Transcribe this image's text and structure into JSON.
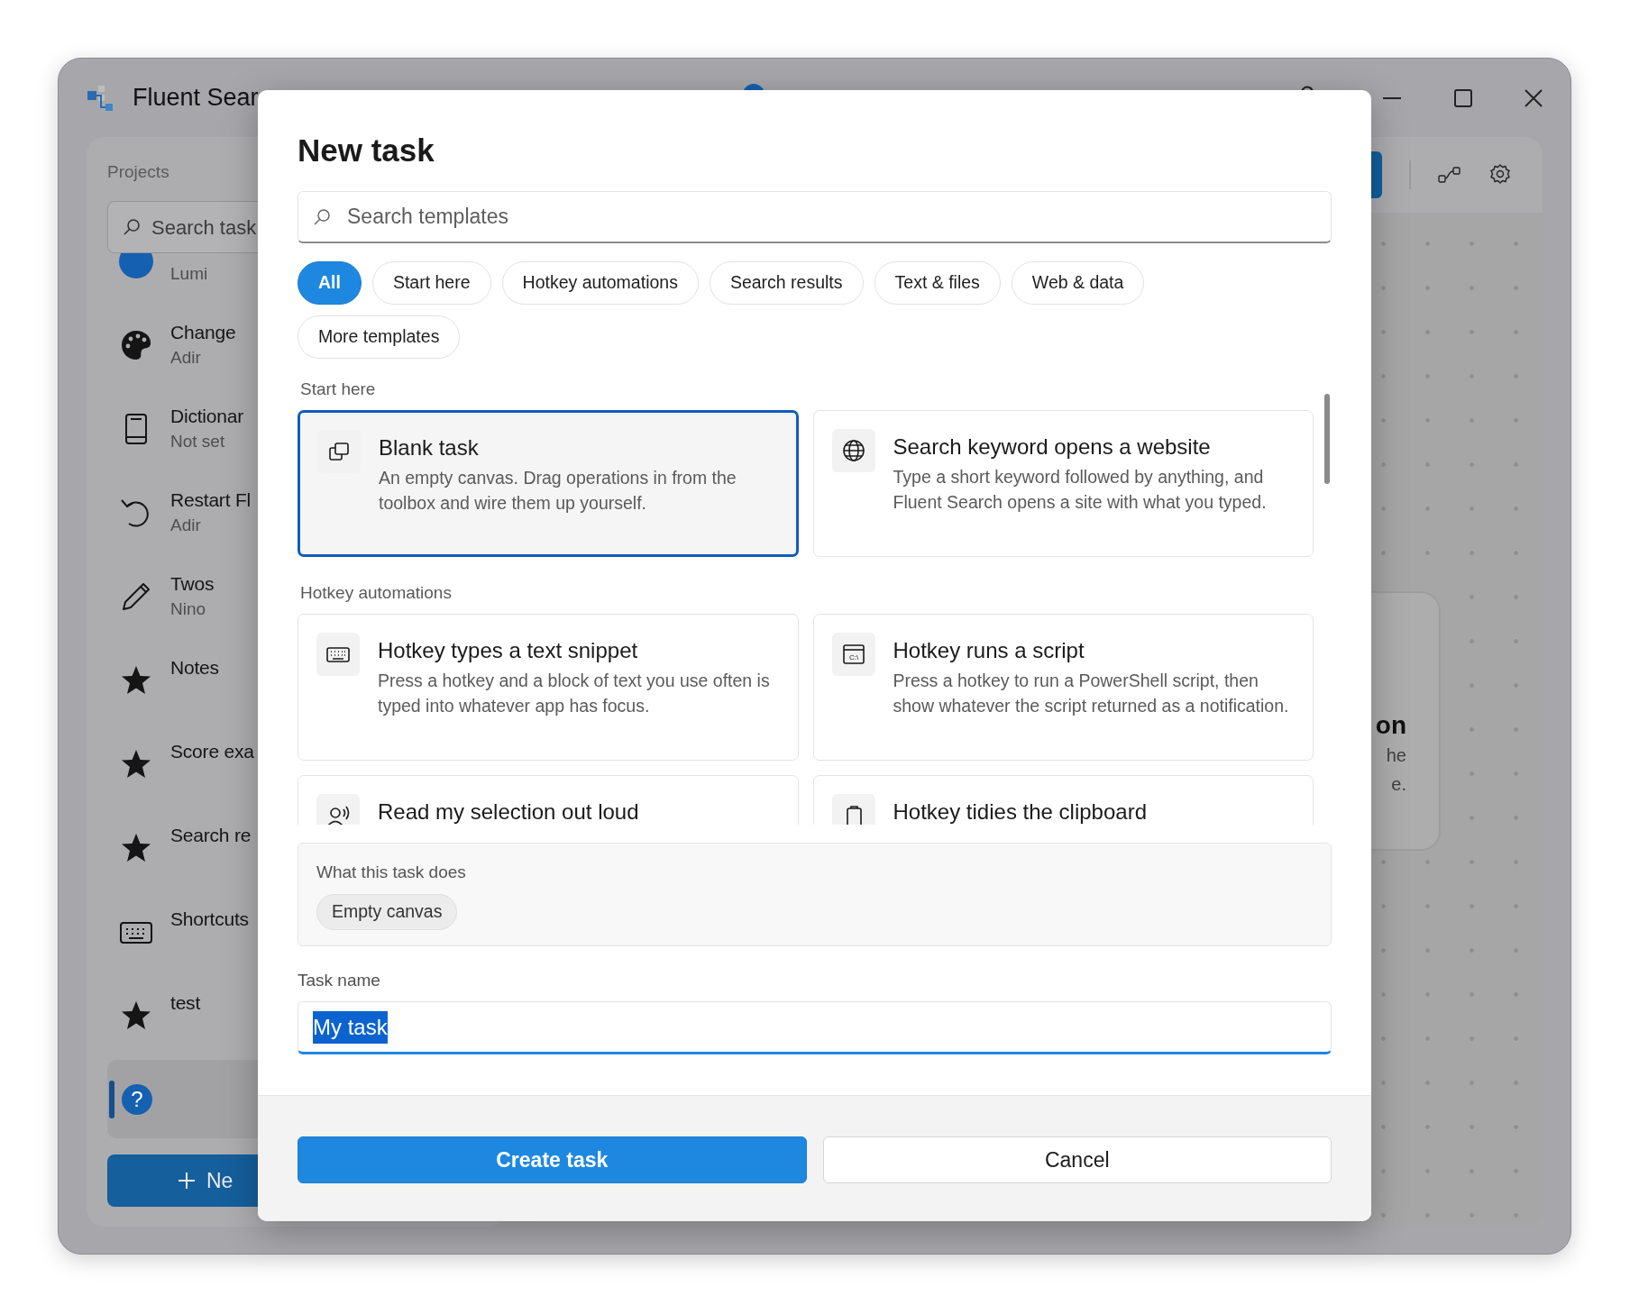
{
  "window": {
    "title": "Fluent Sear"
  },
  "sidebar": {
    "heading": "Projects",
    "search": {
      "placeholder": "Search task"
    },
    "projects": [
      {
        "owner": "Lumi"
      },
      {
        "name": "Change",
        "owner": "Adir"
      },
      {
        "name": "Dictionar",
        "owner": "Not set"
      },
      {
        "name": "Restart Fl",
        "owner": "Adir"
      },
      {
        "name": "Twos",
        "owner": "Nino"
      },
      {
        "name": "Notes"
      },
      {
        "name": "Score exa"
      },
      {
        "name": "Search re"
      },
      {
        "name": "Shortcuts"
      },
      {
        "name": "test"
      }
    ],
    "help": {
      "glyph": "?",
      "selected": true
    },
    "new_button": {
      "label": "Ne"
    }
  },
  "canvas": {
    "card": {
      "title": "on",
      "lines": [
        "he",
        "e."
      ]
    }
  },
  "dialog": {
    "title": "New task",
    "search": {
      "placeholder": "Search templates"
    },
    "filters": [
      {
        "label": "All",
        "selected": true
      },
      {
        "label": "Start here",
        "selected": false
      },
      {
        "label": "Hotkey automations",
        "selected": false
      },
      {
        "label": "Search results",
        "selected": false
      },
      {
        "label": "Text & files",
        "selected": false
      },
      {
        "label": "Web & data",
        "selected": false
      },
      {
        "label": "More templates",
        "selected": false
      }
    ],
    "sections": [
      {
        "heading": "Start here",
        "templates": [
          {
            "title": "Blank task",
            "description": "An empty canvas. Drag operations in from the toolbox and wire them up yourself.",
            "selected": true
          },
          {
            "title": "Search keyword opens a website",
            "description": "Type a short keyword followed by anything, and Fluent Search opens a site with what you typed.",
            "selected": false
          }
        ]
      },
      {
        "heading": "Hotkey automations",
        "templates": [
          {
            "title": "Hotkey types a text snippet",
            "description": "Press a hotkey and a block of text you use often is typed into whatever app has focus.",
            "selected": false
          },
          {
            "title": "Hotkey runs a script",
            "icon_text": "C:\\",
            "description": "Press a hotkey to run a PowerShell script, then show whatever the script returned as a notification.",
            "selected": false
          },
          {
            "title": "Read my selection out loud",
            "selected": false
          },
          {
            "title": "Hotkey tidies the clipboard",
            "selected": false
          }
        ]
      }
    ],
    "summary": {
      "heading": "What this task does",
      "tags": [
        "Empty canvas"
      ]
    },
    "task_name": {
      "label": "Task name",
      "value": "My task",
      "text_selected": true
    },
    "buttons": [
      {
        "label": "Create task",
        "kind": "primary"
      },
      {
        "label": "Cancel",
        "kind": "secondary"
      }
    ]
  }
}
